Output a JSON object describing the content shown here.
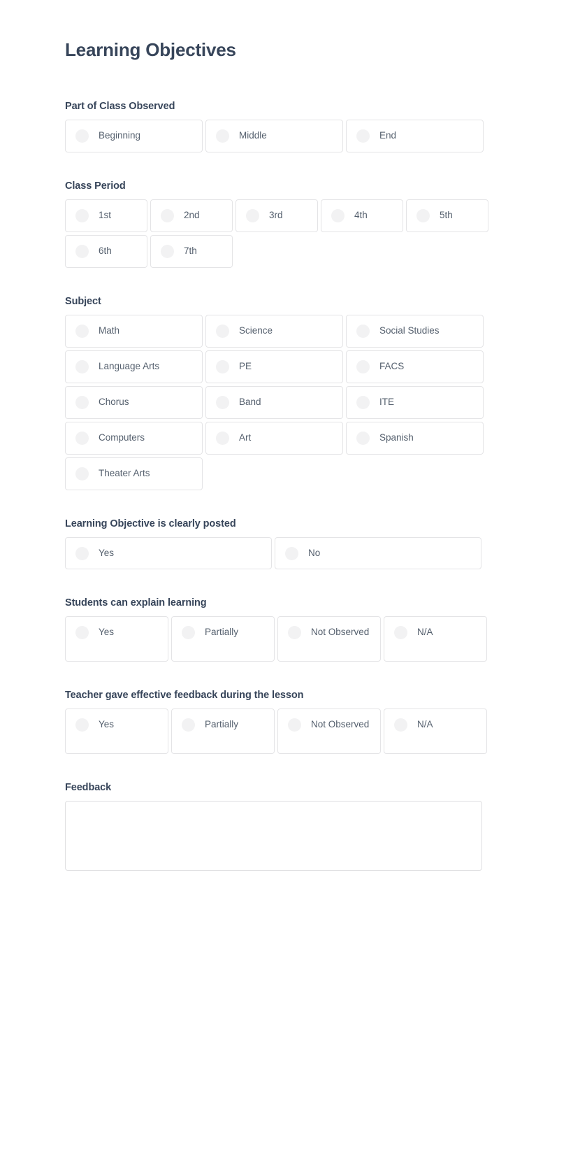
{
  "page": {
    "title": "Learning Objectives"
  },
  "colors": {
    "heading": "#37455a",
    "label": "#55606e",
    "border": "#e4e4e6",
    "radio": "#f2f2f3",
    "background": "#ffffff"
  },
  "sections": [
    {
      "key": "part_of_class_observed",
      "title": "Part of Class Observed",
      "columns": 3,
      "options": [
        {
          "label": "Beginning",
          "selected": false
        },
        {
          "label": "Middle",
          "selected": false
        },
        {
          "label": "End",
          "selected": false
        }
      ]
    },
    {
      "key": "class_period",
      "title": "Class Period",
      "columns": 5,
      "options": [
        {
          "label": "1st",
          "selected": false
        },
        {
          "label": "2nd",
          "selected": false
        },
        {
          "label": "3rd",
          "selected": false
        },
        {
          "label": "4th",
          "selected": false
        },
        {
          "label": "5th",
          "selected": false
        },
        {
          "label": "6th",
          "selected": false
        },
        {
          "label": "7th",
          "selected": false
        }
      ]
    },
    {
      "key": "subject",
      "title": "Subject",
      "columns": 3,
      "options": [
        {
          "label": "Math",
          "selected": false
        },
        {
          "label": "Science",
          "selected": false
        },
        {
          "label": "Social Studies",
          "selected": false
        },
        {
          "label": "Language Arts",
          "selected": false
        },
        {
          "label": "PE",
          "selected": false
        },
        {
          "label": "FACS",
          "selected": false
        },
        {
          "label": "Chorus",
          "selected": false
        },
        {
          "label": "Band",
          "selected": false
        },
        {
          "label": "ITE",
          "selected": false
        },
        {
          "label": "Computers",
          "selected": false
        },
        {
          "label": "Art",
          "selected": false
        },
        {
          "label": "Spanish",
          "selected": false
        },
        {
          "label": "Theater Arts",
          "selected": false
        }
      ]
    },
    {
      "key": "learning_objective_posted",
      "title": "Learning Objective is clearly posted",
      "columns": 2,
      "options": [
        {
          "label": "Yes",
          "selected": false
        },
        {
          "label": "No",
          "selected": false
        }
      ]
    },
    {
      "key": "students_can_explain_learning",
      "title": "Students can explain learning",
      "columns": 4,
      "tall": true,
      "options": [
        {
          "label": "Yes",
          "selected": false
        },
        {
          "label": "Partially",
          "selected": false
        },
        {
          "label": "Not Observed",
          "selected": false
        },
        {
          "label": "N/A",
          "selected": false
        }
      ]
    },
    {
      "key": "teacher_gave_effective_feedback",
      "title": "Teacher gave effective feedback during the lesson",
      "columns": 4,
      "tall": true,
      "options": [
        {
          "label": "Yes",
          "selected": false
        },
        {
          "label": "Partially",
          "selected": false
        },
        {
          "label": "Not Observed",
          "selected": false
        },
        {
          "label": "N/A",
          "selected": false
        }
      ]
    }
  ],
  "feedback": {
    "title": "Feedback",
    "value": "",
    "placeholder": ""
  }
}
